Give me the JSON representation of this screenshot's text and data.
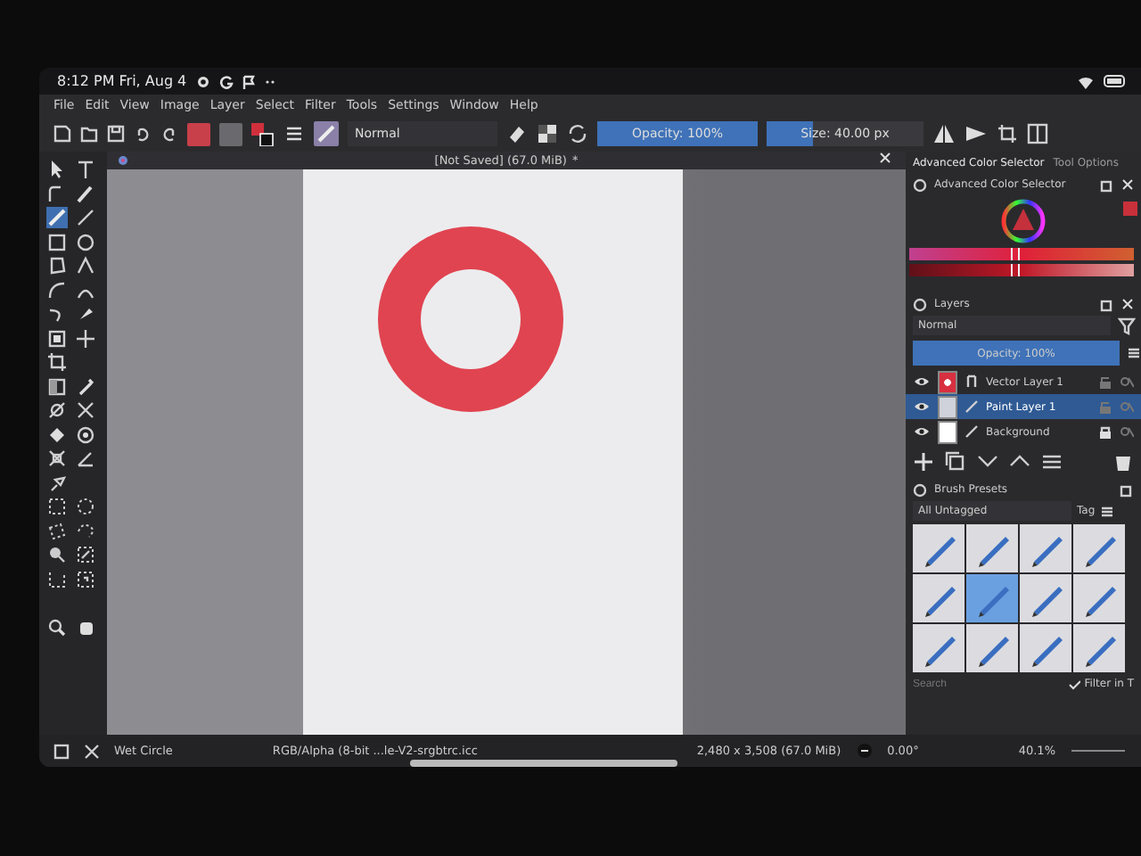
{
  "system_bar": {
    "time": "8:12 PM Fri, Aug 4"
  },
  "menu": [
    "File",
    "Edit",
    "View",
    "Image",
    "Layer",
    "Select",
    "Filter",
    "Tools",
    "Settings",
    "Window",
    "Help"
  ],
  "toolbar": {
    "blend_mode": "Normal",
    "opacity": {
      "label": "Opacity: 100%",
      "level": 1
    },
    "size": {
      "label": "Size: 40.00 px",
      "level": 0.3
    }
  },
  "document_tab": {
    "title": "[Not Saved]  (67.0 MiB)",
    "modified": "*"
  },
  "dock_tabs": [
    {
      "label": "Advanced Color Selector",
      "selected": true
    },
    {
      "label": "Tool Options",
      "selected": false
    }
  ],
  "color_selector": {
    "title": "Advanced Color Selector",
    "sliders": [
      {
        "kind": "hue",
        "level": 0.47
      },
      {
        "kind": "shade",
        "level": 0.47
      }
    ]
  },
  "layers": {
    "title": "Layers",
    "blend_mode": "Normal",
    "opacity": {
      "label": "Opacity:  100%",
      "level": 1
    },
    "items": [
      {
        "name": "Vector Layer 1",
        "kind": "vector",
        "visible": true,
        "selected": false,
        "locked": false
      },
      {
        "name": "Paint Layer 1",
        "kind": "paint",
        "visible": true,
        "selected": true,
        "locked": false
      },
      {
        "name": "Background",
        "kind": "background",
        "visible": true,
        "selected": false,
        "locked": true
      }
    ]
  },
  "brush_presets": {
    "title": "Brush Presets",
    "tag_filter": "All Untagged",
    "tag_button": "Tag",
    "search_placeholder": "Search",
    "filter_option": {
      "label": "Filter in T",
      "checked": true
    },
    "presets": [
      {
        "selected": false
      },
      {
        "selected": false
      },
      {
        "selected": false
      },
      {
        "selected": false
      },
      {
        "selected": false
      },
      {
        "selected": true
      },
      {
        "selected": false
      },
      {
        "selected": false
      },
      {
        "selected": false
      },
      {
        "selected": false
      },
      {
        "selected": false
      },
      {
        "selected": false
      }
    ]
  },
  "status_bar": {
    "brush": "Wet Circle",
    "color_space": "RGB/Alpha (8-bit ...le-V2-srgbtrc.icc",
    "dimensions": "2,480 x 3,508 (67.0 MiB)",
    "rotation": "0.00°",
    "zoom": "40.1%"
  }
}
